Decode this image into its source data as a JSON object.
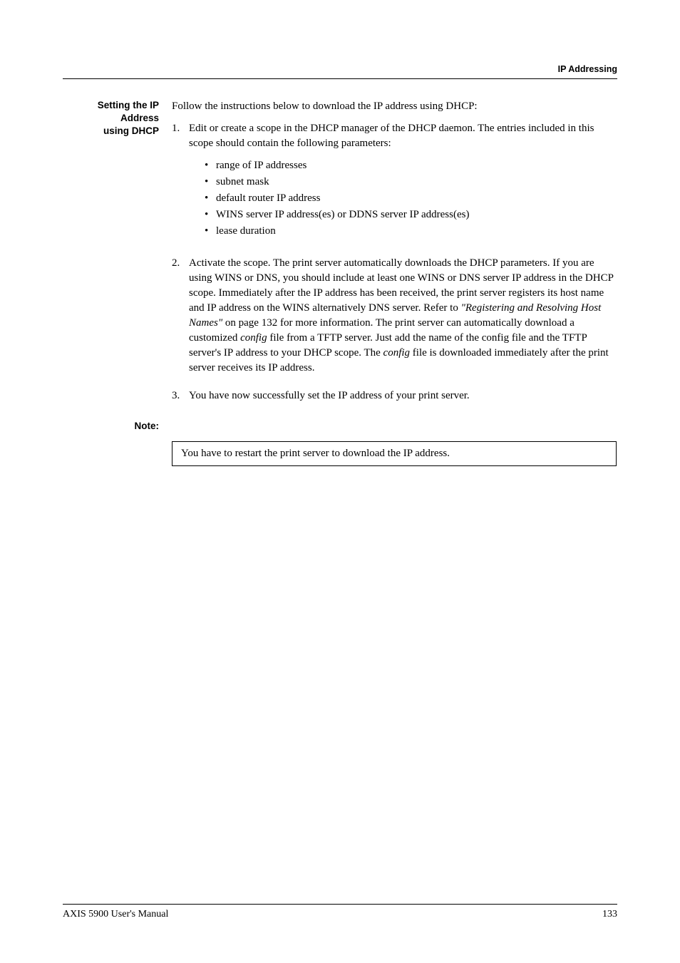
{
  "header": {
    "section": "IP Addressing"
  },
  "sideLabel": {
    "line1": "Setting the IP Address",
    "line2": "using DHCP"
  },
  "intro": "Follow the instructions below to download the IP address using DHCP:",
  "steps": [
    {
      "num": "1.",
      "text": "Edit or create a scope in the DHCP manager of the DHCP daemon. The entries included in this scope should contain the following parameters:",
      "bullets": [
        "range of IP addresses",
        "subnet mask",
        "default router IP address",
        "WINS server IP address(es) or DDNS server IP address(es)",
        "lease duration"
      ]
    },
    {
      "num": "2.",
      "text_parts": {
        "p1": "Activate the scope. The print server automatically downloads the DHCP parameters. If you are using WINS or DNS, you should include at least one WINS or DNS server IP address in the DHCP scope. Immediately after the IP address has been received, the print server registers its host name and IP address on the WINS alternatively DNS server. Refer to ",
        "p2_italic": "\"Registering and Resolving Host Names\"",
        "p3": " on page 132 for more information. The print server can automatically download a customized ",
        "p4_italic": "config",
        "p5": " file from a TFTP server. Just add the name of the config file and the TFTP server's IP address to your DHCP scope. The ",
        "p6_italic": "config",
        "p7": " file is downloaded immediately after the print server receives its IP address."
      }
    },
    {
      "num": "3.",
      "text": "You have now successfully set the IP address of your print server."
    }
  ],
  "note": {
    "label": "Note:",
    "box": "You have to restart the print server to download the IP address."
  },
  "footer": {
    "left": "AXIS 5900 User's Manual",
    "right": "133"
  }
}
